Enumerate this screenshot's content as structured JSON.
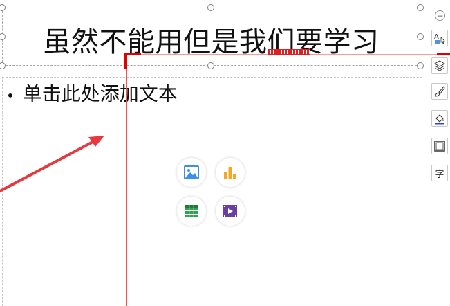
{
  "slide": {
    "title": "虽然不能用但是我们要学习",
    "body_placeholder": "单击此处添加文本",
    "bullet_symbol": "•"
  },
  "placeholder_icons": {
    "items": [
      "image-icon",
      "chart-icon",
      "table-icon",
      "video-icon"
    ],
    "colors": {
      "image": "#3d8ee8",
      "chart": "#f5a623",
      "table": "#2ea44f",
      "video": "#6a3fa0"
    }
  },
  "side_toolbar": {
    "collapse_symbol": "−",
    "tools": [
      "text-format-icon",
      "layers-icon",
      "brush-icon",
      "fill-icon",
      "border-icon",
      "text-icon"
    ],
    "text_tool_label": "字"
  },
  "colors": {
    "guide_red": "#e00000",
    "arrow_red": "#e8383d",
    "selection_border": "#a6a6a6"
  }
}
